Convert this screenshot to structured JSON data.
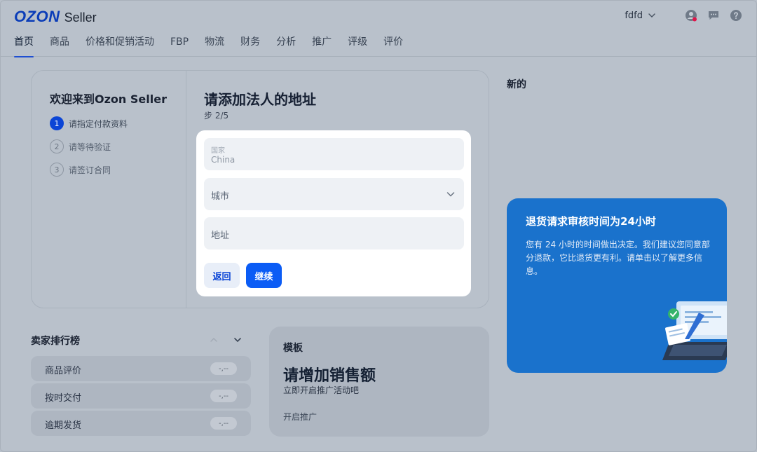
{
  "header": {
    "logo_brand": "OZON",
    "logo_product": "Seller",
    "user_name": "fdfd",
    "nav": [
      {
        "label": "首页"
      },
      {
        "label": "商品"
      },
      {
        "label": "价格和促销活动"
      },
      {
        "label": "FBP"
      },
      {
        "label": "物流"
      },
      {
        "label": "财务"
      },
      {
        "label": "分析"
      },
      {
        "label": "推广"
      },
      {
        "label": "评级"
      },
      {
        "label": "评价"
      }
    ]
  },
  "onboarding": {
    "welcome_title": "欢迎来到Ozon Seller",
    "steps": [
      {
        "num": "1",
        "label": "请指定付款资料",
        "state": "active"
      },
      {
        "num": "2",
        "label": "请等待验证",
        "state": "todo"
      },
      {
        "num": "3",
        "label": "请签订合同",
        "state": "todo"
      }
    ],
    "form_title": "请添加法人的地址",
    "form_step": "步 2/5",
    "country_label": "国家",
    "country_value": "China",
    "city_placeholder": "城市",
    "address_placeholder": "地址",
    "back_label": "返回",
    "continue_label": "继续"
  },
  "news": {
    "title": "新的",
    "promo_title": "退货请求审核时间为24小时",
    "promo_text": "您有 24 小时的时间做出决定。我们建议您同意部分退款，它比退货更有利。请单击以了解更多信息。"
  },
  "rating": {
    "title": "卖家排行榜",
    "rows": [
      {
        "label": "商品评价",
        "value": "-,--"
      },
      {
        "label": "按时交付",
        "value": "-,--"
      },
      {
        "label": "逾期发货",
        "value": "-,--"
      }
    ]
  },
  "template": {
    "tag": "模板",
    "title": "请增加销售额",
    "subtitle": "立即开启推广活动吧",
    "link": "开启推广"
  },
  "colors": {
    "primary": "#0b5cf5",
    "promo_bg": "#1a72cc",
    "overlay_bg": "#b9c1cb"
  }
}
